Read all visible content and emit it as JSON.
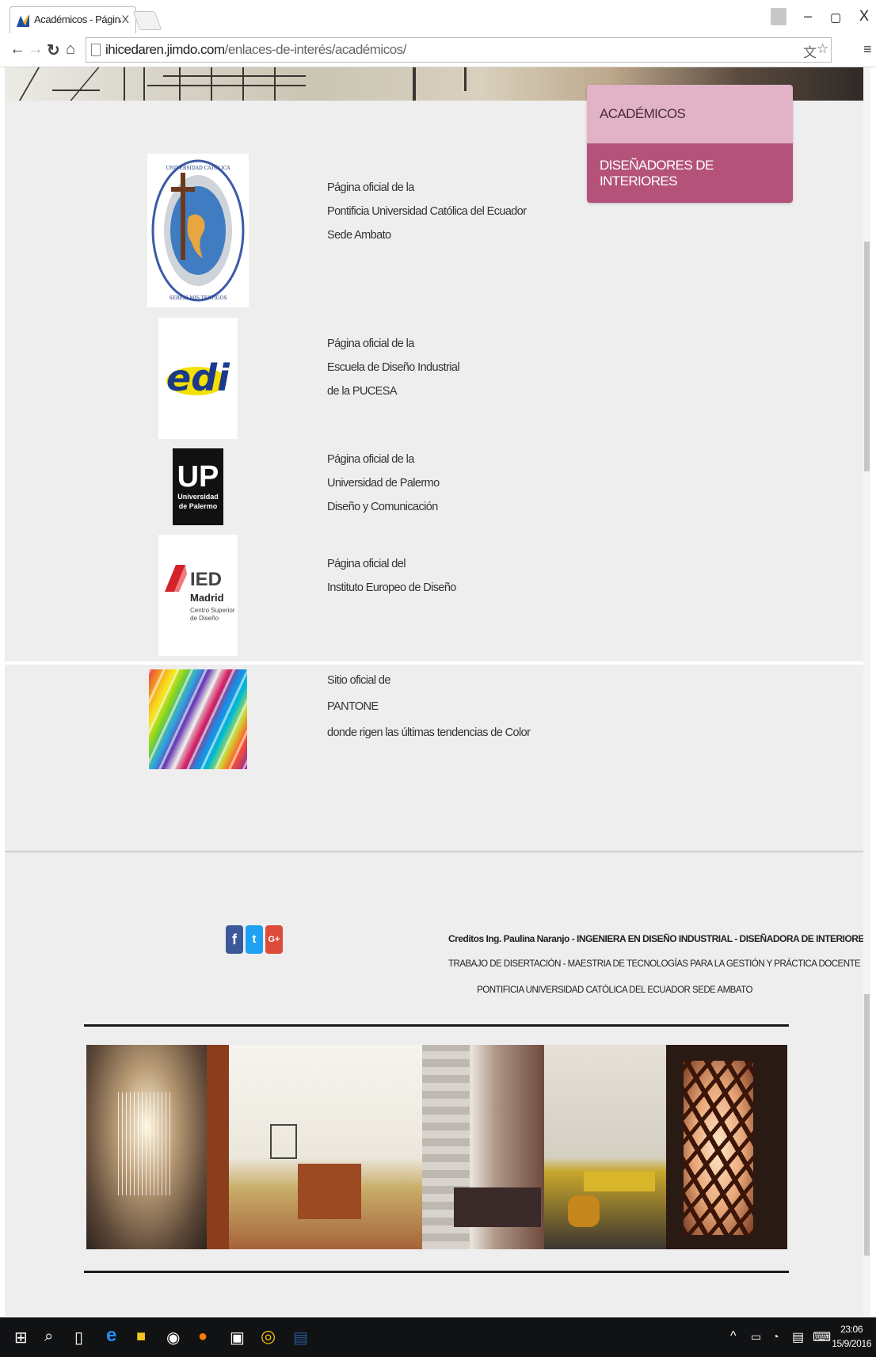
{
  "browser": {
    "tab_title": "Académicos - Página web",
    "tab_close": "X",
    "url_host": "ihicedaren.jimdo.com",
    "url_path": "/enlaces-de-interés/académicos/",
    "window_min": "–",
    "window_max": "▢",
    "window_close": "X"
  },
  "nav": {
    "items": [
      {
        "label": "ACADÉMICOS"
      },
      {
        "label": "DISEÑADORES DE INTERIORES"
      }
    ]
  },
  "links": [
    {
      "logo": "pucesa-seal",
      "logo_text": "PONTIFICIA UNIVERSIDAD CATÓLICA DEL ECUADOR SEDE AMBATO",
      "logo_motto": "SERÉIS MIS TESTIGOS",
      "lines": [
        "Página oficial de la",
        "Pontificia Universidad Católica del Ecuador",
        "Sede Ambato"
      ]
    },
    {
      "logo": "edi-logo",
      "logo_text": "edi",
      "lines": [
        "Página oficial de la",
        "Escuela de Diseño Industrial",
        "de la PUCESA"
      ]
    },
    {
      "logo": "up-logo",
      "logo_text": "UP",
      "logo_sub1": "Universidad",
      "logo_sub2": "de Palermo",
      "lines": [
        "Página oficial de la",
        "Universidad de Palermo",
        "Diseño y Comunicación"
      ]
    },
    {
      "logo": "ied-logo",
      "logo_text": "IED",
      "logo_sub1": "Madrid",
      "logo_sub2": "Centro Superior",
      "logo_sub3": "de Diseño",
      "lines": [
        "Página oficial del",
        "Instituto Europeo de Diseño"
      ]
    },
    {
      "logo": "pantone-swatches",
      "lines": [
        "Sitio oficial de",
        "PANTONE",
        "donde rigen las últimas tendencias de Color"
      ]
    }
  ],
  "footer": {
    "social": [
      "f",
      "t",
      "G+"
    ],
    "credit_line_1": "Creditos Ing. Paulina Naranjo - INGENIERA EN DISEÑO INDUSTRIAL - DISEÑADORA DE INTERIORES",
    "credit_line_2": "TRABAJO DE DISERTACIÓN - MAESTRIA DE TECNOLOGÍAS PARA LA GESTIÓN Y PRÁCTICA DOCENTE",
    "credit_line_3": "PONTIFICIA UNIVERSIDAD CATÓLICA DEL ECUADOR SEDE AMBATO"
  },
  "taskbar": {
    "time": "23:06",
    "date": "15/9/2016"
  }
}
